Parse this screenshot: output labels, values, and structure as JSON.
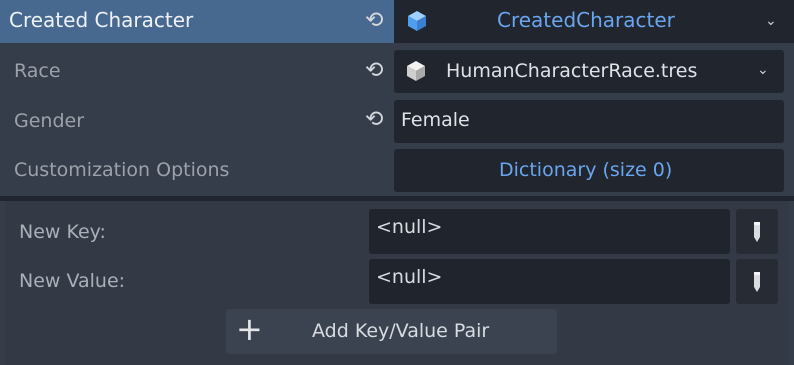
{
  "header": {
    "title": "Created Character",
    "value": "CreatedCharacter"
  },
  "rows": {
    "race": {
      "label": "Race",
      "value": "HumanCharacterRace.tres"
    },
    "gender": {
      "label": "Gender",
      "value": "Female"
    },
    "customization": {
      "label": "Customization Options",
      "value": "Dictionary (size 0)"
    }
  },
  "dictionary_editor": {
    "new_key_label": "New Key:",
    "new_key_value": "<null>",
    "new_value_label": "New Value:",
    "new_value_value": "<null>",
    "add_button_label": "Add Key/Value Pair",
    "add_icon": "+"
  },
  "icons": {
    "revert": "revert-icon",
    "resource": "cube-icon",
    "dropdown": "chevron-down-icon",
    "edit": "pencil-icon"
  },
  "colors": {
    "header_selected": "#47698f",
    "resource_text": "#6aa6ef",
    "background": "#363d4a",
    "field_bg": "#20252e"
  }
}
